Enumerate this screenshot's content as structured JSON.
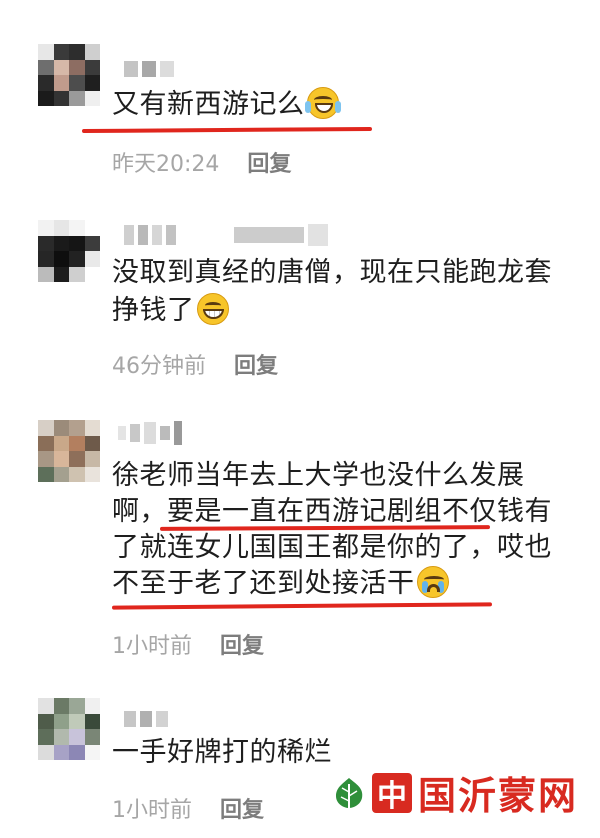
{
  "comments": [
    {
      "text": "又有新西游记么",
      "emoji": "laughing-tears-emoji",
      "time": "昨天20:24",
      "reply": "回复"
    },
    {
      "text_line1": "没取到真经的唐僧，现在只能跑龙套",
      "text_line2": "挣钱了",
      "emoji": "grinning-emoji",
      "time": "46分钟前",
      "reply": "回复"
    },
    {
      "text_line1": "徐老师当年去上大学也没什么发展",
      "text_line2": "啊，要是一直在西游记剧组不仅钱有",
      "text_line3": "了就连女儿国国王都是你的了，哎也",
      "text_line4": "不至于老了还到处接活干",
      "emoji": "crying-emoji",
      "time": "1小时前",
      "reply": "回复"
    },
    {
      "text": "一手好牌打的稀烂",
      "time": "1小时前",
      "reply": "回复"
    }
  ],
  "watermark": {
    "badge": "中",
    "text": "国沂蒙网"
  },
  "colors": {
    "underline": "#e0261d",
    "meta": "#a6a6a6",
    "reply": "#7d7d7d",
    "watermark": "#d82a20"
  }
}
